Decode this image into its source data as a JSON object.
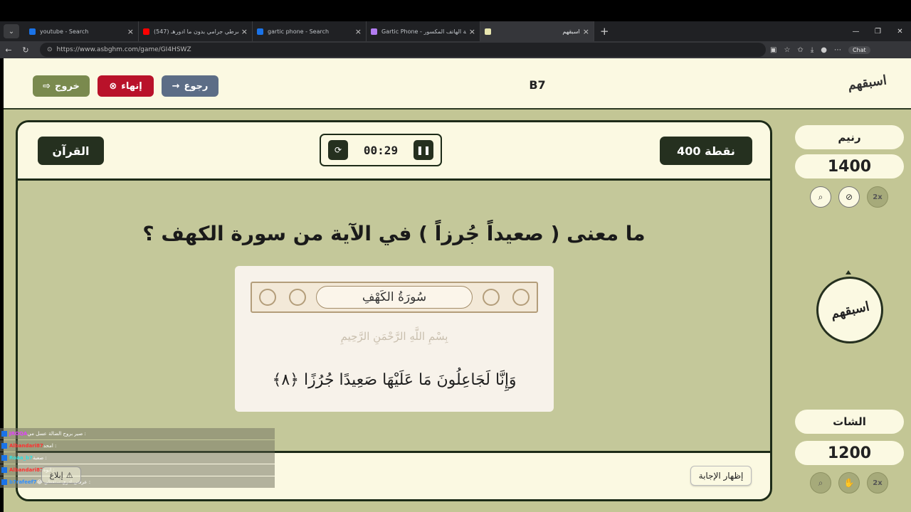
{
  "browser": {
    "tabs": [
      {
        "title": "youtube - Search",
        "icon_color": "#1a73e8"
      },
      {
        "title": "(547) شرطي جرامي بدون ما ادورهـ !",
        "icon_color": "#ff0000"
      },
      {
        "title": "gartic phone - Search",
        "icon_color": "#1a73e8"
      },
      {
        "title": "Gartic Phone - لعبة الهاتف المكسور",
        "icon_color": "#b27cf0"
      },
      {
        "title": "اسبقهم",
        "icon_color": "#e8e6b0",
        "active": true
      }
    ],
    "url": "https://www.asbghm.com/game/GI4HSWZ",
    "chat_label": "Chat"
  },
  "header": {
    "exit_label": "خروج",
    "end_label": "إنهاء",
    "back_label": "رجوع",
    "room_code": "B7",
    "logo_text": "اسبقهم"
  },
  "game": {
    "category": "القرآن",
    "points": "400 نقطة",
    "timer": "00:29",
    "question": "ما معنى ( صعيداً جُرزاً ) في الآية من سورة الكهف ؟",
    "surah_title": "سُورَةُ الكَهْفِ",
    "basmala": "بِسْمِ اللَّهِ الرَّحْمَنِ الرَّحِيمِ",
    "verse": "وَإِنَّا لَجَاعِلُونَ مَا عَلَيْهَا صَعِيدًا جُرُزًا ﴿٨﴾",
    "show_answer_label": "إظهار الإجابة"
  },
  "teams": [
    {
      "name": "رنيم",
      "score": "1400"
    },
    {
      "name": "الشات",
      "score": "1200"
    }
  ],
  "center_logo": "اسبقهم",
  "chat_messages": [
    {
      "user": "JROQA",
      "text": ": صير بروح الضالة عسل مي"
    },
    {
      "user": "Albandari87",
      "text": ": امحد"
    },
    {
      "user": "Roaa_b7",
      "text": ": صعبة"
    },
    {
      "user": "Albandari87",
      "text": ": ايوه"
    },
    {
      "user": "b7rafeef7",
      "text": ": عرفتي ادري ستعطي 😂"
    }
  ],
  "report_label": "إبلاغ"
}
